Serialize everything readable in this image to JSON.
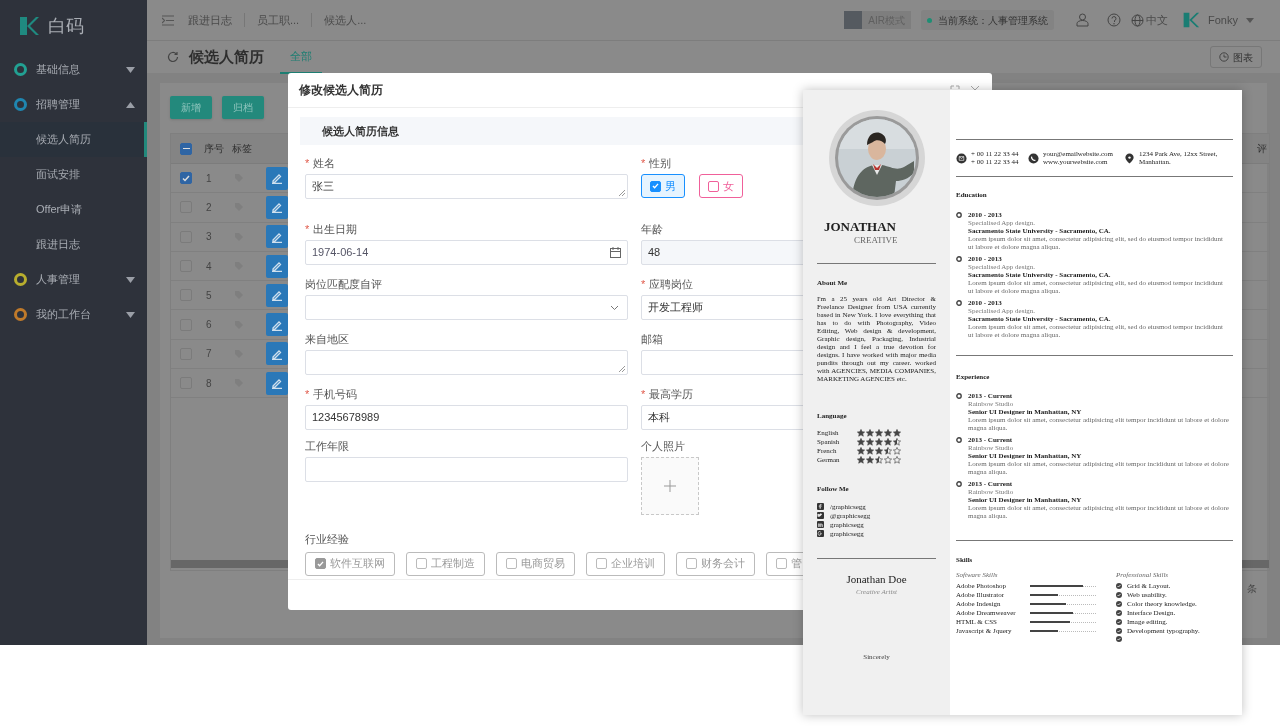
{
  "sidebar": {
    "logo": "白码",
    "items": [
      {
        "label": "基础信息",
        "color": "#22a193",
        "expanded": false
      },
      {
        "label": "招聘管理",
        "color": "#1f86b0",
        "expanded": true,
        "children": [
          {
            "label": "候选人简历",
            "selected": true
          },
          {
            "label": "面试安排",
            "selected": false
          },
          {
            "label": "Offer申请",
            "selected": false
          },
          {
            "label": "跟进日志",
            "selected": false
          }
        ]
      },
      {
        "label": "人事管理",
        "color": "#b8ae2e",
        "expanded": false
      },
      {
        "label": "我的工作台",
        "color": "#c07a2a",
        "expanded": false
      }
    ]
  },
  "topbar": {
    "breadcrumbs": [
      "跟进日志",
      "员工职...",
      "候选人..."
    ],
    "air_mode": "AIR模式",
    "system": "当前系统：人事管理系统",
    "language": "中文",
    "user": "Fonky"
  },
  "page": {
    "title": "候选人简历",
    "tabs": [
      {
        "label": "全部",
        "selected": true
      }
    ],
    "chart_button": "图表",
    "buttons": [
      "新增",
      "归档"
    ],
    "table": {
      "columns": [
        "序号",
        "标签"
      ],
      "right_column_fragment": "评",
      "indeterminate": true,
      "rows": [
        {
          "no": "1",
          "checked": true
        },
        {
          "no": "2",
          "checked": false
        },
        {
          "no": "3",
          "checked": false
        },
        {
          "no": "4",
          "checked": false
        },
        {
          "no": "5",
          "checked": false
        },
        {
          "no": "6",
          "checked": false
        },
        {
          "no": "7",
          "checked": false
        },
        {
          "no": "8",
          "checked": false
        }
      ]
    },
    "pagination_fragment": "条"
  },
  "modal": {
    "title": "修改候选人简历",
    "section": "候选人简历信息",
    "fields": [
      {
        "kind": "textarea",
        "label": "姓名",
        "required_mark": "*",
        "value": "张三"
      },
      {
        "kind": "gender",
        "label": "性别",
        "required_mark": "*",
        "options": [
          {
            "label": "男",
            "checked": true,
            "color": "#1890ff"
          },
          {
            "label": "女",
            "checked": false,
            "color": "#f0609a"
          }
        ]
      },
      {
        "kind": "date",
        "label": "出生日期",
        "required_mark": "*",
        "value": "1974-06-14"
      },
      {
        "kind": "readonly",
        "label": "年龄",
        "value": "48"
      },
      {
        "kind": "select",
        "label": "岗位匹配度自评"
      },
      {
        "kind": "text",
        "label": "应聘岗位",
        "required_mark": "*",
        "value": "开发工程师"
      },
      {
        "kind": "textarea",
        "label": "来自地区"
      },
      {
        "kind": "text",
        "label": "邮箱"
      },
      {
        "kind": "text",
        "label": "手机号码",
        "required_mark": "*",
        "value": "12345678989"
      },
      {
        "kind": "text",
        "label": "最高学历",
        "required_mark": "*",
        "value": "本科"
      },
      {
        "kind": "text",
        "label": "工作年限"
      },
      {
        "kind": "upload",
        "label": "个人照片"
      }
    ],
    "industry": {
      "label": "行业经验",
      "options": [
        {
          "label": "软件互联网",
          "checked": true
        },
        {
          "label": "工程制造",
          "checked": false
        },
        {
          "label": "电商贸易",
          "checked": false
        },
        {
          "label": "企业培训",
          "checked": false
        },
        {
          "label": "财务会计",
          "checked": false
        },
        {
          "label": "管",
          "checked": false
        }
      ]
    }
  },
  "resume": {
    "name": "JONATHAN",
    "subtitle": "CREATIVE",
    "about_heading": "About Me",
    "about": "I'm a 25 years old Art Director & Freelance Designer from USA currently based in New York. I love everything that has to do with Photography, Video Editing, Web design & development, Graphic design, Packaging, Industrial design and I feel a true devotion for designs. I have worked with major media pundits through out my career. worked with AGENCIES, MEDIA COMPANIES, MARKETING AGENCIES etc.",
    "language_heading": "Language",
    "languages": [
      {
        "name": "English",
        "stars": 5
      },
      {
        "name": "Spanish",
        "stars": 4.5
      },
      {
        "name": "French",
        "stars": 3.5
      },
      {
        "name": "German",
        "stars": 2.5
      }
    ],
    "follow_heading": "Follow Me",
    "socials": [
      {
        "kind": "facebook",
        "handle": "/graphicsegg"
      },
      {
        "kind": "twitter",
        "handle": "@graphicsegg"
      },
      {
        "kind": "linkedin",
        "handle": "graphicsegg"
      },
      {
        "kind": "pinterest",
        "handle": "graphicsegg"
      }
    ],
    "signature": "Jonathan Doe",
    "signature_title": "Creative Artist",
    "closing": "Sincerely",
    "contacts": [
      {
        "kind": "mail",
        "lines": [
          "+ 00 11 22 33 44",
          "+ 00 11 22 33 44"
        ]
      },
      {
        "kind": "phone",
        "lines": [
          "your@emailwebsite.com",
          "www.yourwebsite.com"
        ]
      },
      {
        "kind": "pin",
        "lines": [
          "1234 Park Ave, 12xx Street,",
          "Manhattan."
        ]
      }
    ],
    "education_heading": "Education",
    "education": [
      {
        "years": "2010 - 2013",
        "subtitle": "Specialised App design.",
        "title": "Sacramento State University - Sacramento, CA.",
        "text": "Lorem ipsum dolor sit amet, consectetur adipisicing elit, sed do eiusmod tempor incididunt ut labore et dolore magna aliqua."
      },
      {
        "years": "2010 - 2013",
        "subtitle": "Specialised App design.",
        "title": "Sacramento State University - Sacramento, CA.",
        "text": "Lorem ipsum dolor sit amet, consectetur adipisicing elit, sed do eiusmod tempor incididunt ut labore et dolore magna aliqua."
      },
      {
        "years": "2010 - 2013",
        "subtitle": "Specialised App design.",
        "title": "Sacramento State University - Sacramento, CA.",
        "text": "Lorem ipsum dolor sit amet, consectetur adipisicing elit, sed do eiusmod tempor incididunt ut labore et dolore magna aliqua."
      }
    ],
    "experience_heading": "Experience",
    "experience": [
      {
        "years": "2013 - Current",
        "subtitle": "Rainbow Studio",
        "title": "Senior UI Designer in Manhattan, NY",
        "text": "Lorem ipsum dolor sit amet, consectetur adipisicing elit tempor incididunt ut labore et dolore magna aliqua."
      },
      {
        "years": "2013 - Current",
        "subtitle": "Rainbow Studio",
        "title": "Senior UI Designer in Manhattan, NY",
        "text": "Lorem ipsum dolor sit amet, consectetur adipisicing elit tempor incididunt ut labore et dolore magna aliqua."
      },
      {
        "years": "2013 - Current",
        "subtitle": "Rainbow Studio",
        "title": "Senior UI Designer in Manhattan, NY",
        "text": "Lorem ipsum dolor sit amet, consectetur adipisicing elit tempor incididunt ut labore et dolore magna aliqua."
      }
    ],
    "skills_heading": "Skills",
    "software_heading": "Software Skills",
    "software": [
      {
        "name": "Adobe Photoshop",
        "level": 0.8
      },
      {
        "name": "Adobe Illustrator",
        "level": 0.42
      },
      {
        "name": "Adobe Indesign",
        "level": 0.55
      },
      {
        "name": "Adobe Dreamweaver",
        "level": 0.65
      },
      {
        "name": "HTML & CSS",
        "level": 0.6
      },
      {
        "name": "Javascript & Jquery",
        "level": 0.42
      }
    ],
    "professional_heading": "Professional Skills",
    "professional": [
      "Grid & Layout.",
      "Web usability.",
      "Color theory knowledge.",
      "Interface Design.",
      "Image editing.",
      "Development typography."
    ]
  }
}
